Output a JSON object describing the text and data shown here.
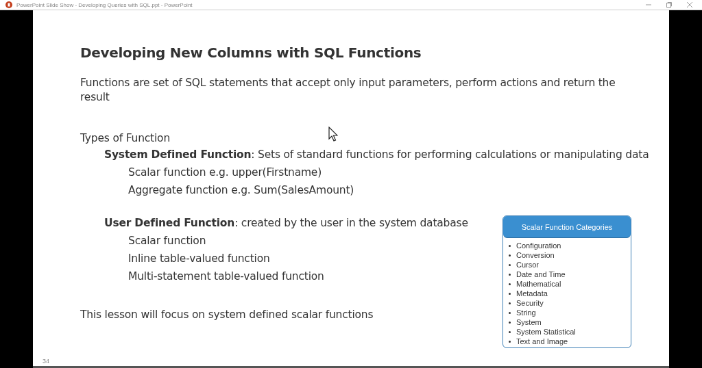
{
  "window": {
    "title": "PowerPoint Slide Show  -  Developing Queries with SQL.ppt  -  PowerPoint"
  },
  "slide": {
    "title": "Developing New Columns with SQL Functions",
    "intro": "Functions are set of SQL statements that accept only input parameters, perform actions and return the result",
    "types_heading": "Types of Function",
    "groups": [
      {
        "term": "System Defined Function",
        "description": ": Sets of standard functions for performing calculations or manipulating data",
        "items": [
          "Scalar function e.g. upper(Firstname)",
          "Aggregate function e.g. Sum(SalesAmount)"
        ]
      },
      {
        "term": "User Defined Function",
        "description": ": created by the user in the system database",
        "items": [
          "Scalar function",
          "Inline table-valued function",
          "Multi-statement table-valued function"
        ]
      }
    ],
    "focus": "This lesson will focus on system defined scalar functions",
    "callout": {
      "title": "Scalar Function Categories",
      "items": [
        "Configuration",
        "Conversion",
        "Cursor",
        "Date and Time",
        "Mathematical",
        "Metadata",
        "Security",
        "String",
        "System",
        "System Statistical",
        "Text and Image"
      ]
    },
    "page_number": "34"
  }
}
